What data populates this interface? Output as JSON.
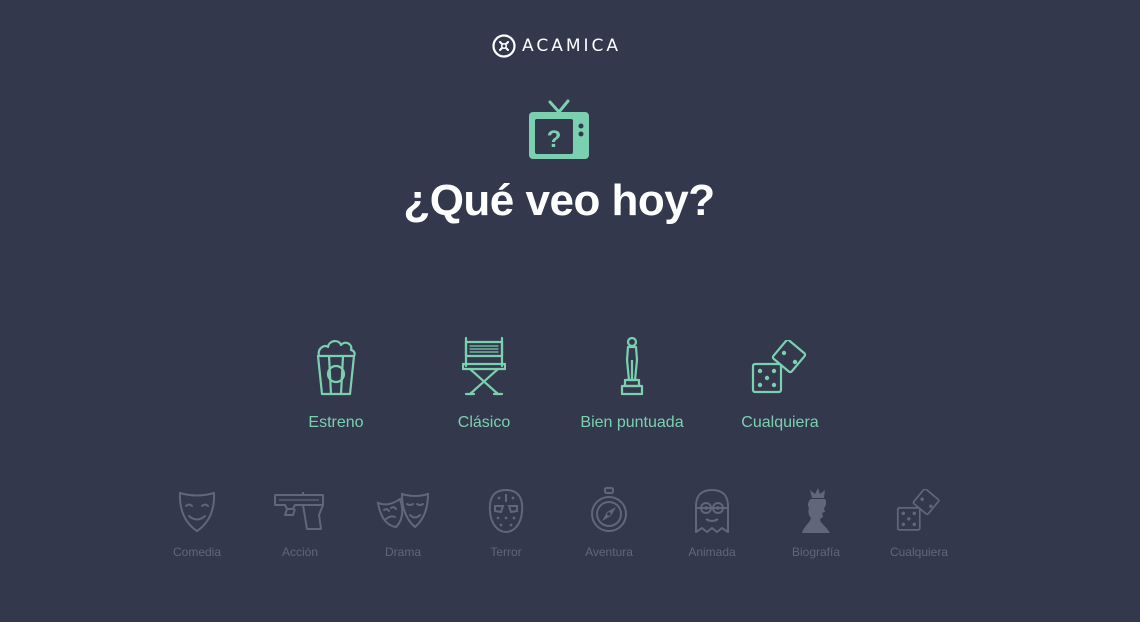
{
  "brand": {
    "name": "ACAMICA"
  },
  "hero": {
    "icon": "tv-question-icon",
    "title": "¿Qué veo hoy?"
  },
  "colors": {
    "background": "#33384d",
    "accent": "#7bd0b0",
    "muted": "#616778",
    "title": "#ffffff"
  },
  "primary_categories": [
    {
      "label": "Estreno",
      "icon": "popcorn-icon"
    },
    {
      "label": "Clásico",
      "icon": "director-chair-icon"
    },
    {
      "label": "Bien puntuada",
      "icon": "oscar-statue-icon"
    },
    {
      "label": "Cualquiera",
      "icon": "dice-icon"
    }
  ],
  "genres": [
    {
      "label": "Comedia",
      "icon": "comedy-mask-icon"
    },
    {
      "label": "Acción",
      "icon": "gun-icon"
    },
    {
      "label": "Drama",
      "icon": "drama-masks-icon"
    },
    {
      "label": "Terror",
      "icon": "hockey-mask-icon"
    },
    {
      "label": "Aventura",
      "icon": "compass-icon"
    },
    {
      "label": "Animada",
      "icon": "minion-icon"
    },
    {
      "label": "Biografía",
      "icon": "queen-bust-icon"
    },
    {
      "label": "Cualquiera",
      "icon": "dice-icon"
    }
  ]
}
